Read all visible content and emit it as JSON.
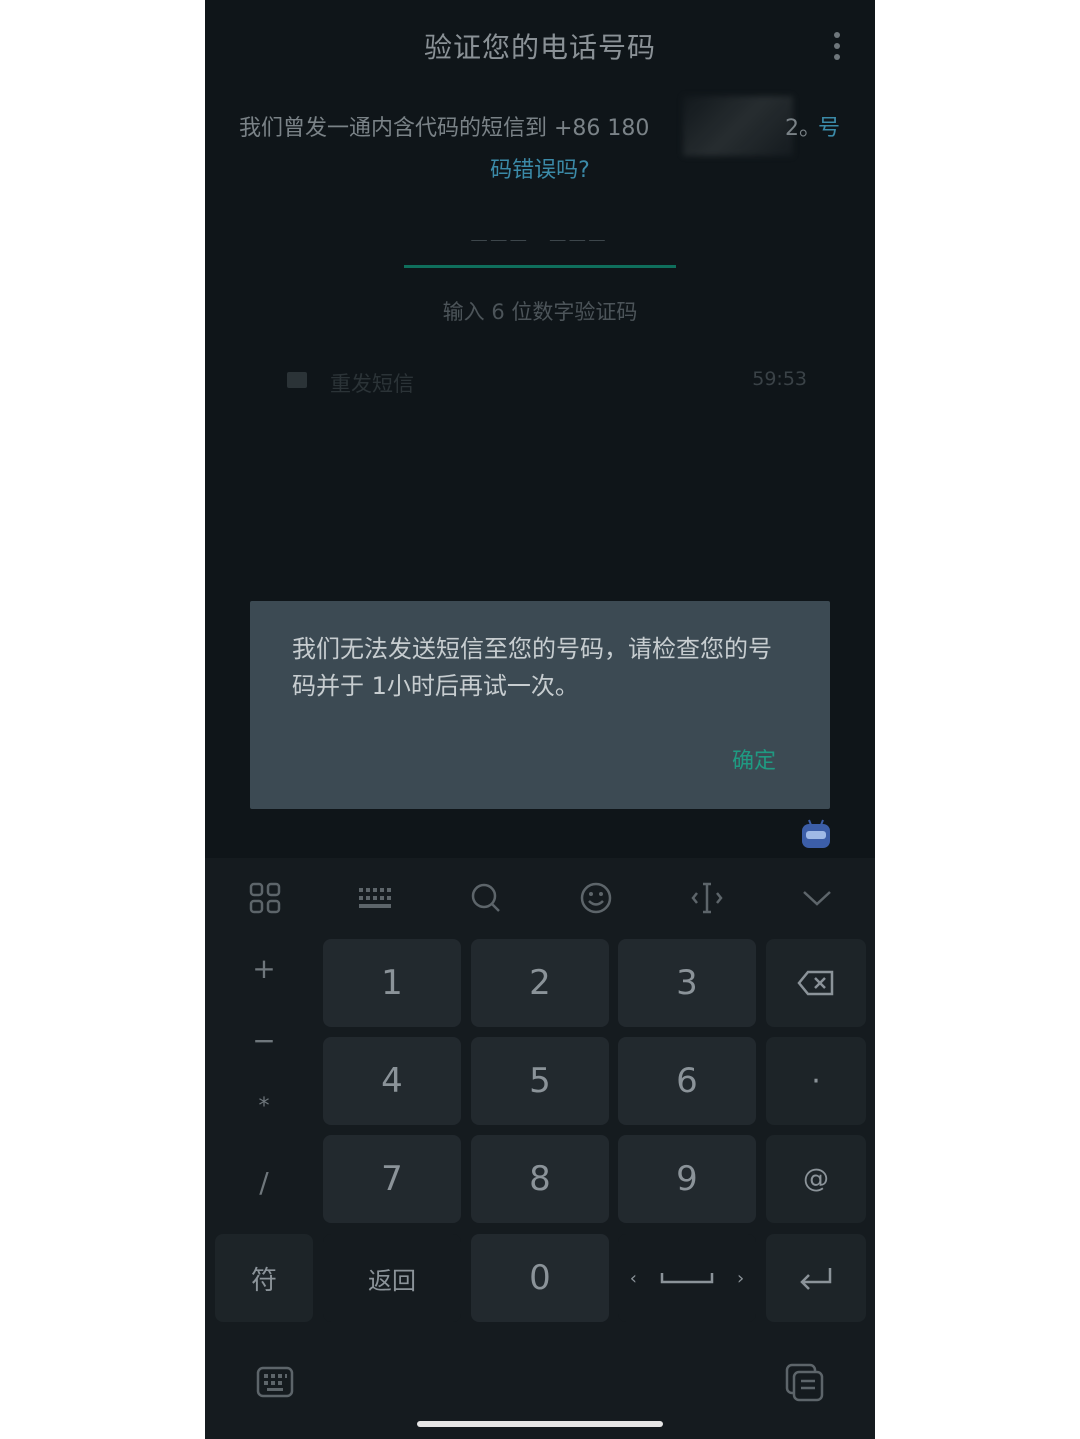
{
  "header": {
    "title": "验证您的电话号码"
  },
  "info": {
    "line1": "我们曾发一通内含代码的短信到 +86 180",
    "line1_tail": "2。",
    "wrong_link_a": "号",
    "wrong_link_b": "码错误吗?"
  },
  "code": {
    "display": "___ ___",
    "hint": "输入 6 位数字验证码"
  },
  "resend": {
    "label": "重发短信",
    "timer": "59:53"
  },
  "dialog": {
    "message": "我们无法发送短信至您的号码，请检查您的号码并于 1小时后再试一次。",
    "ok_label": "确定"
  },
  "keyboard": {
    "toolbar_icons": [
      "grid-icon",
      "keyboard-icon",
      "search-icon",
      "emoji-icon",
      "cursor-icon",
      "chevron-down-icon"
    ],
    "left_column": [
      "+",
      "−",
      "*",
      "/"
    ],
    "rows": [
      [
        "1",
        "2",
        "3"
      ],
      [
        "4",
        "5",
        "6"
      ],
      [
        "7",
        "8",
        "9"
      ]
    ],
    "right_column": [
      "⌫",
      "·",
      "@"
    ],
    "bottom": {
      "symbols": "符",
      "back": "返回",
      "zero": "0",
      "space_left": "‹",
      "space_right": "›"
    }
  }
}
